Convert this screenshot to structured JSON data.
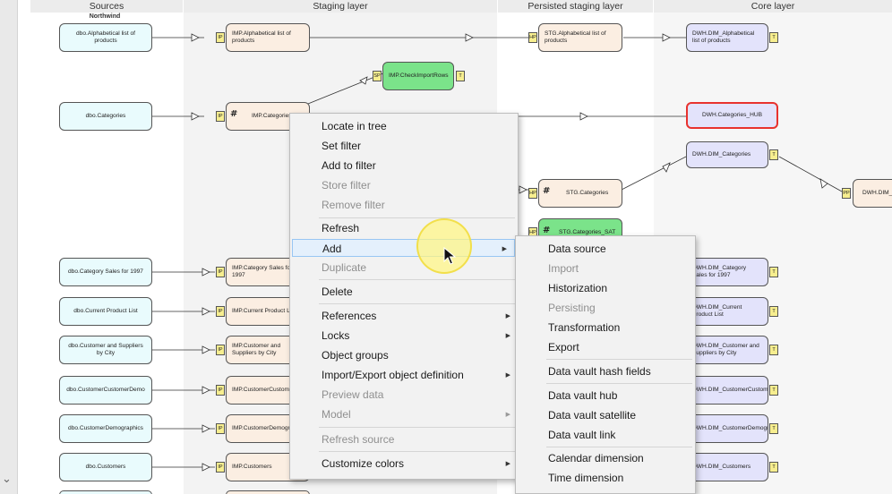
{
  "lanes": {
    "sources": "Sources",
    "staging": "Staging layer",
    "persisted": "Persisted staging layer",
    "core": "Core layer"
  },
  "source_group": "Northwind",
  "nodes": {
    "src_alpha": "dbo.Alphabetical list of products",
    "src_categories": "dbo.Categories",
    "src_cat_sales": "dbo.Category Sales for 1997",
    "src_current_product": "dbo.Current Product List",
    "src_customer_suppliers": "dbo.Customer and Suppliers by City",
    "src_customer_demo": "dbo.CustomerCustomerDemo",
    "src_customer_demographics": "dbo.CustomerDemographics",
    "src_customers": "dbo.Customers",
    "imp_alpha": "IMP.Alphabetical list of products",
    "imp_categories": "IMP.Categories",
    "imp_check": "IMP.CheckImportRows",
    "imp_cat_sales": "IMP.Category Sales for 1997",
    "imp_current_product": "IMP.Current Product List",
    "imp_customer_suppliers": "IMP.Customer and Suppliers by City",
    "imp_customer_demo": "IMP.CustomerCustomerDemo",
    "imp_customer_demographics": "IMP.CustomerDemographics",
    "imp_customers": "IMP.Customers",
    "stg_alpha": "STG.Alphabetical list of products",
    "stg_categories": "STG.Categories",
    "stg_categories_sat": "STG.Categories_SAT",
    "dwh_alpha": "DWH.DIM_Alphabetical list of products",
    "dwh_categories_hub": "DWH.Categories_HUB",
    "dwh_dim_categories": "DWH.DIM_Categories",
    "dwh_dim_partial": "DWH.DIM_",
    "dwh_cat_sales": "DWH.DIM_Category Sales for 1997",
    "dwh_current_product": "DWH.DIM_Current Product List",
    "dwh_customer_suppliers": "DWH.DIM_Customer and Suppliers by City",
    "dwh_customer_demo": "DWH.DIM_CustomerCustomerDemo",
    "dwh_customer_demographics": "DWH.DIM_CustomerDemographics",
    "dwh_customers": "DWH.DIM_Customers"
  },
  "tags": {
    "ip": "IP",
    "hp": "HP",
    "sp": "SP",
    "t": "T",
    "pp": "PP",
    "hash": "#"
  },
  "context_menu": {
    "items": [
      {
        "label": "Locate in tree",
        "enabled": true
      },
      {
        "label": "Set filter",
        "enabled": true
      },
      {
        "label": "Add to filter",
        "enabled": true
      },
      {
        "label": "Store filter",
        "enabled": false
      },
      {
        "label": "Remove filter",
        "enabled": false
      },
      {
        "label": "Refresh",
        "enabled": true
      },
      {
        "label": "Add",
        "enabled": true,
        "submenu": true,
        "active": true
      },
      {
        "label": "Duplicate",
        "enabled": false
      },
      {
        "label": "Delete",
        "enabled": true
      },
      {
        "label": "References",
        "enabled": true,
        "submenu": true
      },
      {
        "label": "Locks",
        "enabled": true,
        "submenu": true
      },
      {
        "label": "Object groups",
        "enabled": true
      },
      {
        "label": "Import/Export object definition",
        "enabled": true,
        "submenu": true
      },
      {
        "label": "Preview data",
        "enabled": false
      },
      {
        "label": "Model",
        "enabled": false,
        "submenu": true
      },
      {
        "label": "Refresh source",
        "enabled": false
      },
      {
        "label": "Customize colors",
        "enabled": true,
        "submenu": true
      }
    ]
  },
  "add_submenu": {
    "items": [
      {
        "label": "Data source",
        "enabled": true
      },
      {
        "label": "Import",
        "enabled": false
      },
      {
        "label": "Historization",
        "enabled": true
      },
      {
        "label": "Persisting",
        "enabled": false
      },
      {
        "label": "Transformation",
        "enabled": true
      },
      {
        "label": "Export",
        "enabled": true
      },
      {
        "label": "Data vault hash fields",
        "enabled": true
      },
      {
        "label": "Data vault hub",
        "enabled": true
      },
      {
        "label": "Data vault satellite",
        "enabled": true
      },
      {
        "label": "Data vault link",
        "enabled": true
      },
      {
        "label": "Calendar dimension",
        "enabled": true
      },
      {
        "label": "Time dimension",
        "enabled": true
      }
    ]
  },
  "colors": {
    "source_fill": "#e9fbfd",
    "staging_fill": "#fbeee2",
    "core_fill": "#e3e3fb",
    "green_fill": "#7be38a",
    "highlight_border": "#e8322e",
    "tag_fill": "#f7ee8f",
    "menu_active": "#e4f0fc"
  }
}
